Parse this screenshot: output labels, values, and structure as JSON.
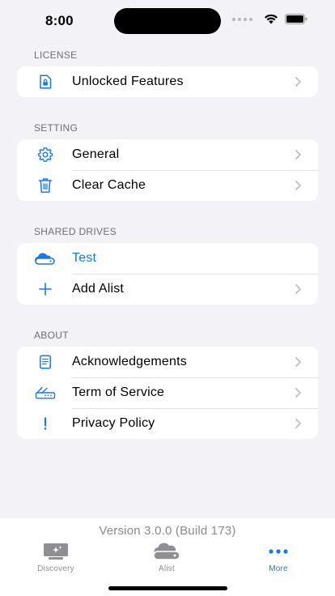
{
  "status_bar": {
    "time": "8:00"
  },
  "sections": [
    {
      "header": "LICENSE",
      "rows": [
        {
          "label": "Unlocked Features",
          "icon": "license-doc-icon",
          "chevron": true
        }
      ]
    },
    {
      "header": "SETTING",
      "rows": [
        {
          "label": "General",
          "icon": "gear-icon",
          "chevron": true
        },
        {
          "label": "Clear Cache",
          "icon": "trash-icon",
          "chevron": true
        }
      ]
    },
    {
      "header": "SHARED DRIVES",
      "rows": [
        {
          "label": "Test",
          "icon": "cloud-drive-icon",
          "chevron": false
        },
        {
          "label": "Add Alist",
          "icon": "plus-icon",
          "chevron": true
        }
      ]
    },
    {
      "header": "ABOUT",
      "rows": [
        {
          "label": "Acknowledgements",
          "icon": "document-icon",
          "chevron": true
        },
        {
          "label": "Term of Service",
          "icon": "router-icon",
          "chevron": true
        },
        {
          "label": "Privacy Policy",
          "icon": "exclamation-icon",
          "chevron": true
        }
      ]
    }
  ],
  "footer": {
    "version": "Version 3.0.0 (Build 173)"
  },
  "tabs": [
    {
      "label": "Discovery",
      "icon": "discovery-icon",
      "active": false
    },
    {
      "label": "Alist",
      "icon": "alist-drive-icon",
      "active": false
    },
    {
      "label": "More",
      "icon": "more-dots-icon",
      "active": true
    }
  ],
  "colors": {
    "accent": "#1479ea",
    "background": "#f2f2f7",
    "secondary_text": "#6d6d72"
  }
}
